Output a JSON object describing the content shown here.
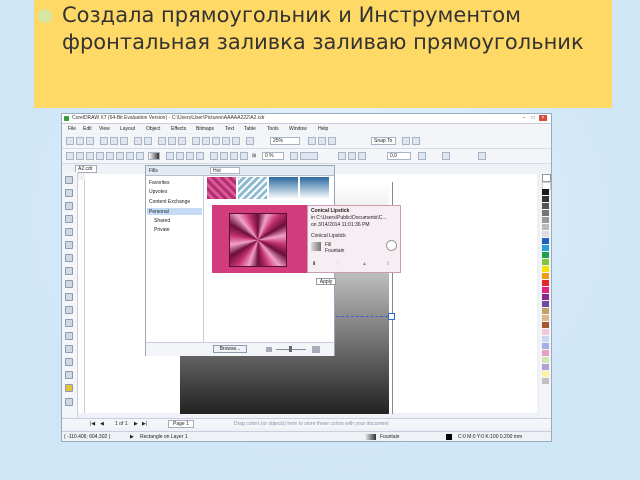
{
  "slide": {
    "title": "Создала прямоугольник и Инструментом фронтальная заливка заливаю прямоугольник"
  },
  "app": {
    "title": "CorelDRAW X7 (64-Bit Evaluation Version) - C:\\Users\\User\\Pictures\\AAAAA222\\A2.cdr",
    "menu": [
      "File",
      "Edit",
      "View",
      "Layout",
      "Object",
      "Effects",
      "Bitmaps",
      "Text",
      "Table",
      "Tools",
      "Window",
      "Help"
    ],
    "zoom": "25%",
    "snap_to": "Snap To",
    "percent": "0 %",
    "offset": "0,0",
    "doc_tab": "A2.cdr"
  },
  "fill_panel": {
    "header": "Fills",
    "hot": "Hot",
    "tree": [
      "Favorites",
      "Upvotes",
      "Content Exchange",
      "Personal",
      "Shared",
      "Private"
    ],
    "browse": "Browse..."
  },
  "info_popup": {
    "name": "Conical Lipstick",
    "path": "in C:\\Users\\Public\\Documents\\C...",
    "date": "on 3/14/2014 11:01:36 PM",
    "name2": "Conical Lipstick",
    "type1": "Fill",
    "type2": "Fountain",
    "apply_tip": "Apply"
  },
  "status": {
    "page_info": "1 of 1",
    "page_tab": "Page 1",
    "hint": "Drag colors (or objects) here to store these colors with your document",
    "coords": "( -110.406; 604.302 )",
    "object": "Rectangle on Layer 1",
    "fill": "Fountain",
    "outline": "C:0 M:0 Y:0 K:100  0.200 mm"
  },
  "colors": {
    "slide_bg": "#cfe6f7",
    "title_band": "#ffd966",
    "bullet": "#d7e6a3",
    "popup_pink": "#d23b7c"
  }
}
